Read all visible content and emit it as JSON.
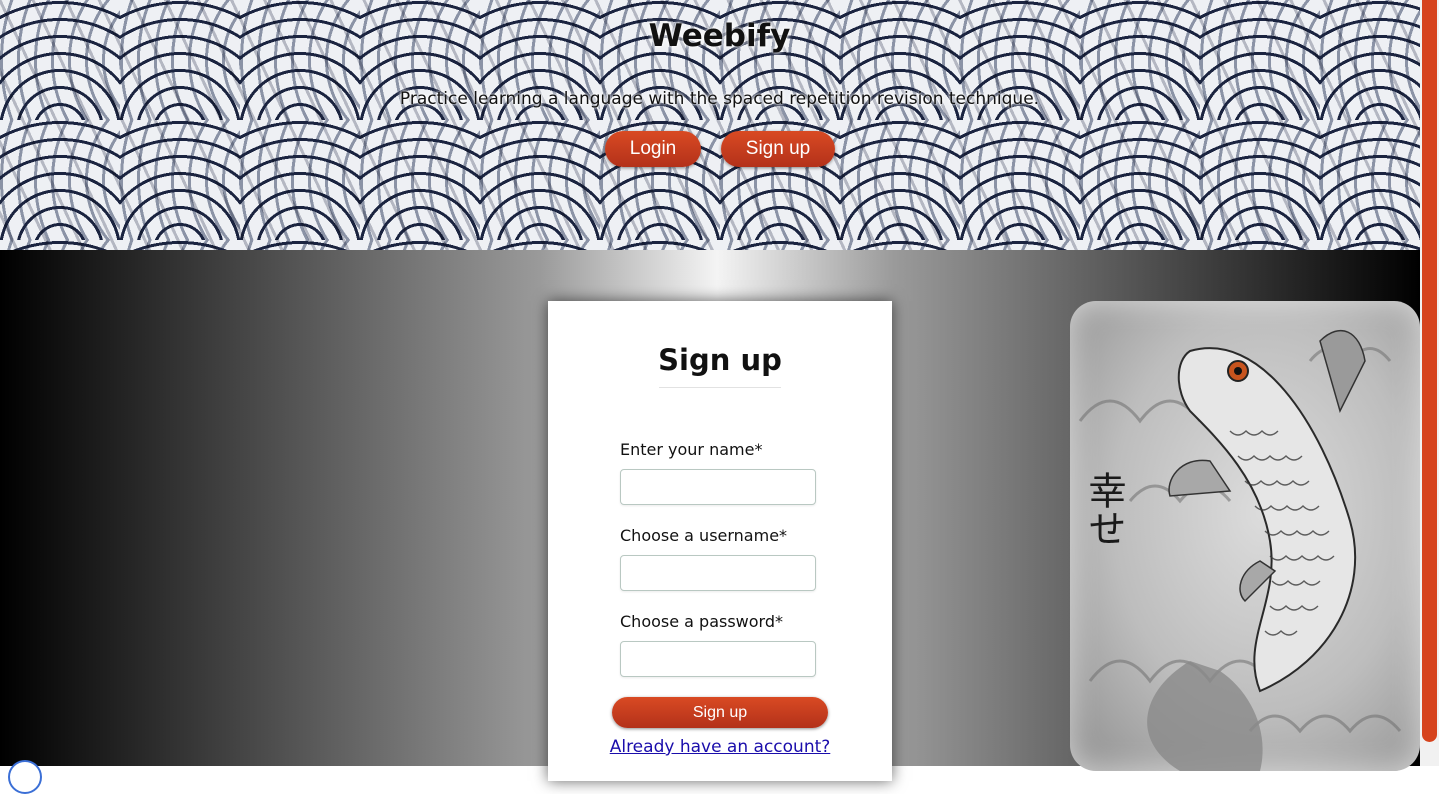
{
  "header": {
    "brand": "Weebify",
    "tagline": "Practice learning a language with the spaced repetition revision technique.",
    "login_label": "Login",
    "signup_label": "Sign up"
  },
  "form": {
    "title": "Sign up",
    "name_label": "Enter your name*",
    "name_value": "",
    "username_label": "Choose a username*",
    "username_value": "",
    "password_label": "Choose a password*",
    "password_value": "",
    "submit_label": "Sign up",
    "account_link": "Already have an account?"
  },
  "artwork": {
    "kanji": "幸せ"
  },
  "colors": {
    "accent": "#c83a1e",
    "link": "#1a0dab"
  }
}
